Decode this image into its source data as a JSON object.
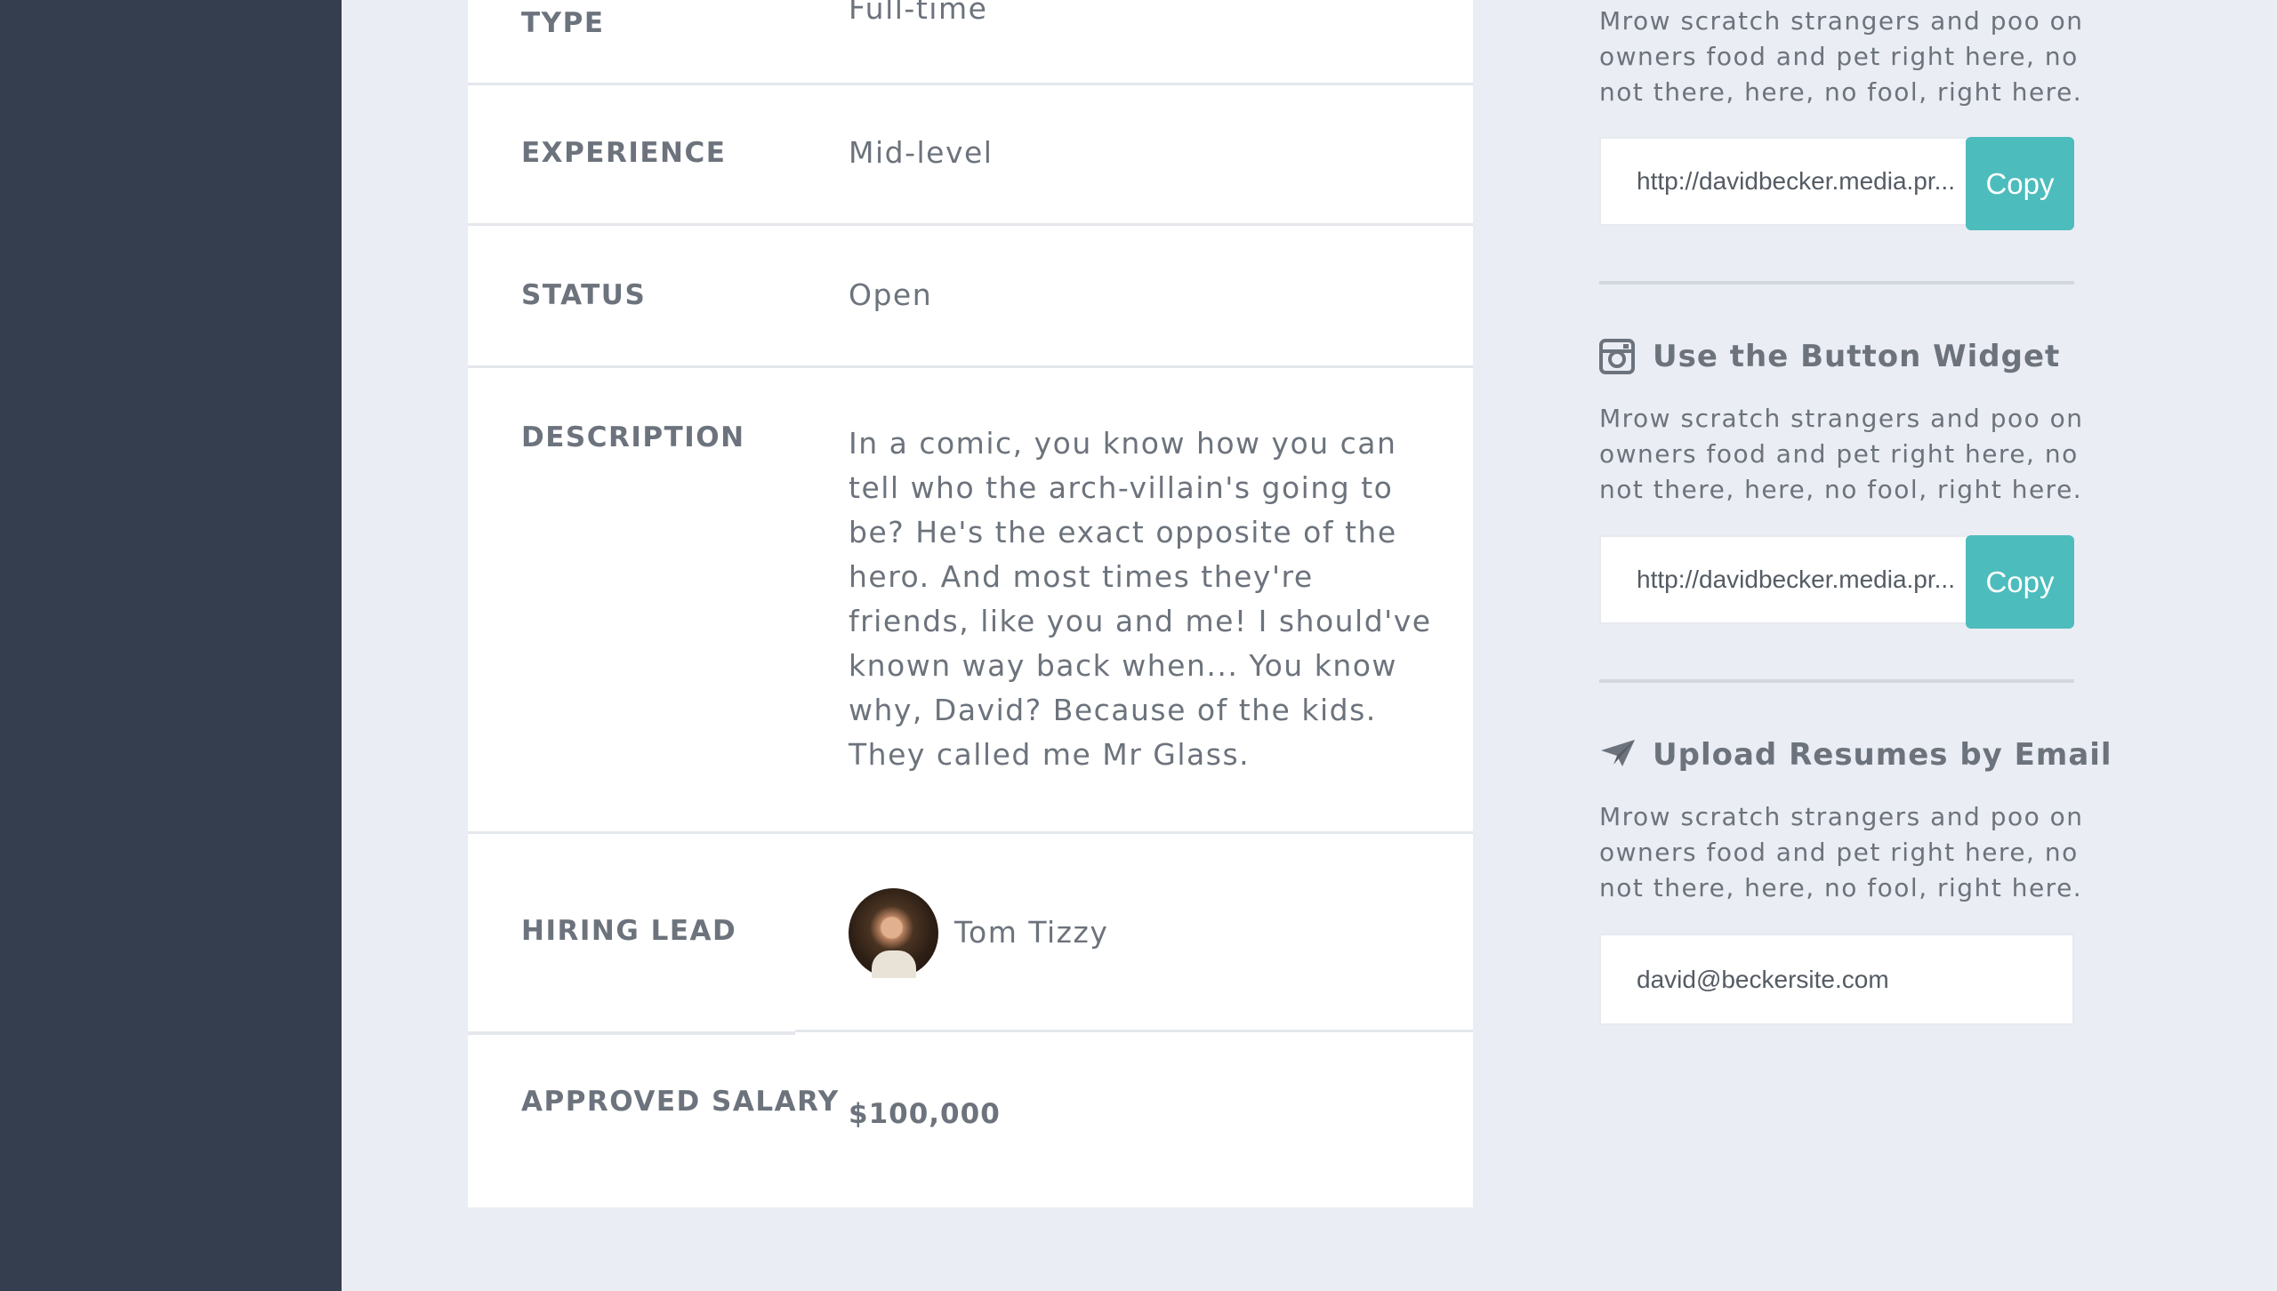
{
  "details": {
    "type": {
      "label": "TYPE",
      "value": "Full-time"
    },
    "experience": {
      "label": "EXPERIENCE",
      "value": "Mid-level"
    },
    "status": {
      "label": "STATUS",
      "value": "Open"
    },
    "description": {
      "label": "DESCRIPTION",
      "value": "In a comic, you know how you can tell who the arch-villain's going to be? He's the exact opposite of the hero. And most times they're friends, like you and me! I should've known way back when... You know why, David? Because of the kids. They called me Mr Glass."
    },
    "hiring_lead": {
      "label": "HIRING LEAD",
      "name": "Tom Tizzy"
    },
    "salary": {
      "label": "APPROVED SALARY",
      "value": "$100,000"
    }
  },
  "widgets": {
    "top": {
      "text": "Mrow scratch strangers and poo on owners food and pet right here, no not there, here, no fool, right here.",
      "url": "http://davidbecker.media.pr...",
      "copy_label": "Copy"
    },
    "button": {
      "icon": "instagram-icon",
      "title": "Use the Button Widget",
      "text": "Mrow scratch strangers and poo on owners food and pet right here, no not there, here, no fool, right here.",
      "url": "http://davidbecker.media.pr...",
      "copy_label": "Copy"
    },
    "email": {
      "icon": "paper-plane-icon",
      "title": "Upload Resumes by Email",
      "text": "Mrow scratch strangers and poo on owners food and pet right here, no not there, here, no fool, right here.",
      "address": "david@beckersite.com"
    }
  },
  "colors": {
    "sidebar": "#343e4f",
    "background": "#eaedf3",
    "accent": "#4dbcbd",
    "text": "#6c737c"
  }
}
